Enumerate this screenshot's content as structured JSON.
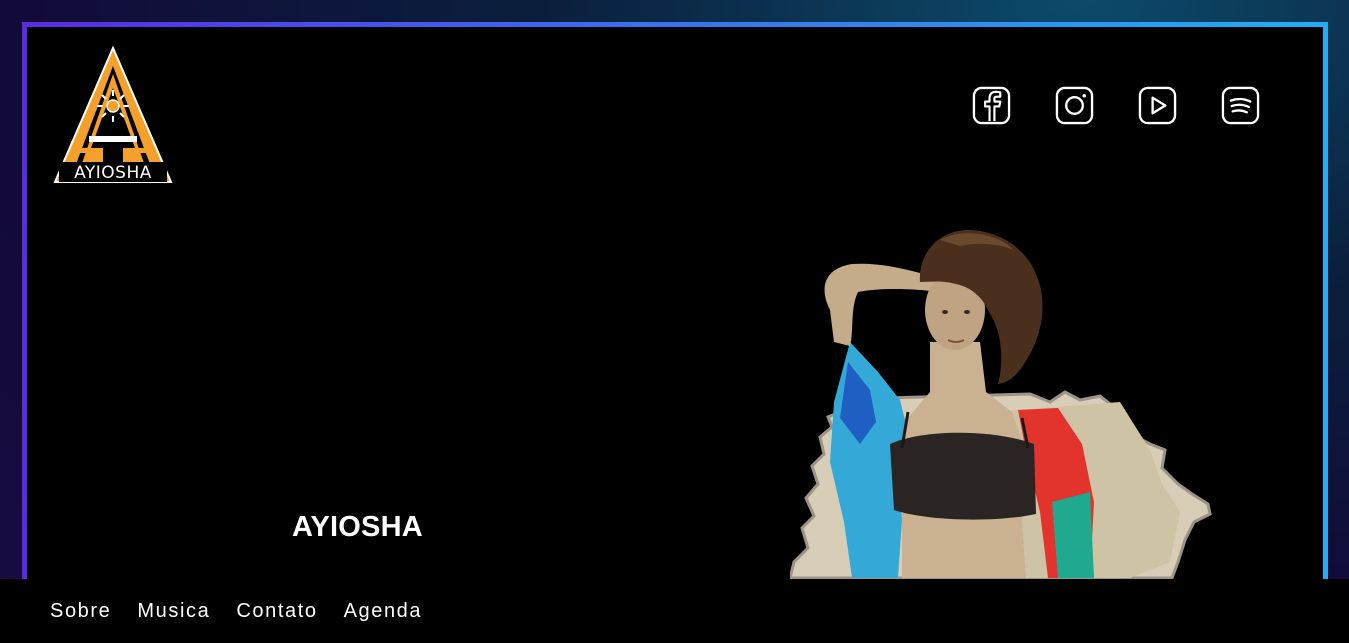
{
  "brand": {
    "logo_text": "AYIOSHA",
    "accent_color": "#f5a02a"
  },
  "social": {
    "items": [
      {
        "name": "facebook",
        "icon": "facebook-icon"
      },
      {
        "name": "instagram",
        "icon": "instagram-icon"
      },
      {
        "name": "youtube",
        "icon": "youtube-icon"
      },
      {
        "name": "spotify",
        "icon": "spotify-icon"
      }
    ]
  },
  "hero": {
    "artist_name": "AYIOSHA"
  },
  "nav": {
    "items": [
      {
        "label": "Sobre"
      },
      {
        "label": "Musica"
      },
      {
        "label": "Contato"
      },
      {
        "label": "Agenda"
      }
    ]
  },
  "theme": {
    "frame_gradient_start": "#5a2ce0",
    "frame_gradient_end": "#21aef5",
    "background": "#000000"
  }
}
